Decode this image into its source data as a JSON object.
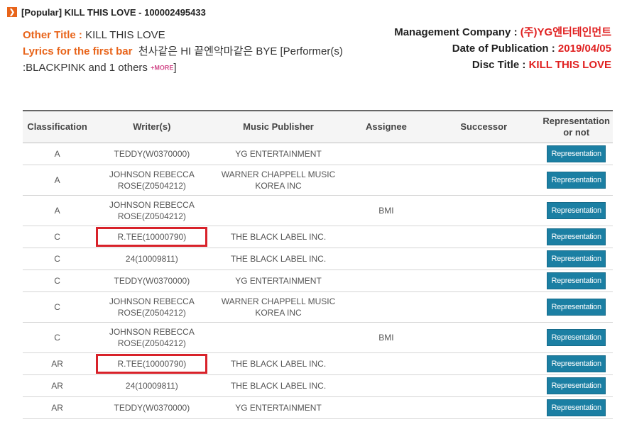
{
  "header": {
    "icon": "chevron-right-icon",
    "title": "[Popular] KILL THIS LOVE - 100002495433"
  },
  "info": {
    "other_title_label": "Other Title :",
    "other_title_value": "KILL THIS LOVE",
    "lyrics_label": "Lyrics for the first bar",
    "lyrics_value": "천사같은 HI 끝엔악마같은 BYE [Performer(s) :BLACKPINK and 1 others",
    "more_label": "+MORE",
    "lyrics_close": "]",
    "mgmt_label": "Management Company :",
    "mgmt_value": "(주)YG엔터테인먼트",
    "date_label": "Date of Publication :",
    "date_value": "2019/04/05",
    "disc_label": "Disc Title :",
    "disc_value": "KILL THIS LOVE"
  },
  "table": {
    "columns": [
      "Classification",
      "Writer(s)",
      "Music Publisher",
      "Assignee",
      "Successor",
      "Representation or not"
    ],
    "button_label": "Representation",
    "rows": [
      {
        "classification": "A",
        "writer": "TEDDY(W0370000)",
        "publisher": "YG ENTERTAINMENT",
        "assignee": "",
        "successor": ""
      },
      {
        "classification": "A",
        "writer": "JOHNSON REBECCA ROSE(Z0504212)",
        "publisher": "WARNER CHAPPELL MUSIC KOREA INC",
        "assignee": "",
        "successor": ""
      },
      {
        "classification": "A",
        "writer": "JOHNSON REBECCA ROSE(Z0504212)",
        "publisher": "",
        "assignee": "BMI",
        "successor": ""
      },
      {
        "classification": "C",
        "writer": "R.TEE(10000790)",
        "publisher": "THE BLACK LABEL INC.",
        "assignee": "",
        "successor": ""
      },
      {
        "classification": "C",
        "writer": "24(10009811)",
        "publisher": "THE BLACK LABEL INC.",
        "assignee": "",
        "successor": ""
      },
      {
        "classification": "C",
        "writer": "TEDDY(W0370000)",
        "publisher": "YG ENTERTAINMENT",
        "assignee": "",
        "successor": ""
      },
      {
        "classification": "C",
        "writer": "JOHNSON REBECCA ROSE(Z0504212)",
        "publisher": "WARNER CHAPPELL MUSIC KOREA INC",
        "assignee": "",
        "successor": ""
      },
      {
        "classification": "C",
        "writer": "JOHNSON REBECCA ROSE(Z0504212)",
        "publisher": "",
        "assignee": "BMI",
        "successor": ""
      },
      {
        "classification": "AR",
        "writer": "R.TEE(10000790)",
        "publisher": "THE BLACK LABEL INC.",
        "assignee": "",
        "successor": ""
      },
      {
        "classification": "AR",
        "writer": "24(10009811)",
        "publisher": "THE BLACK LABEL INC.",
        "assignee": "",
        "successor": ""
      },
      {
        "classification": "AR",
        "writer": "TEDDY(W0370000)",
        "publisher": "YG ENTERTAINMENT",
        "assignee": "",
        "successor": ""
      }
    ]
  },
  "colors": {
    "accent_orange": "#e8641a",
    "value_red": "#e02020",
    "button_blue": "#1b7fa3",
    "highlight_box_red": "#d8222a"
  }
}
